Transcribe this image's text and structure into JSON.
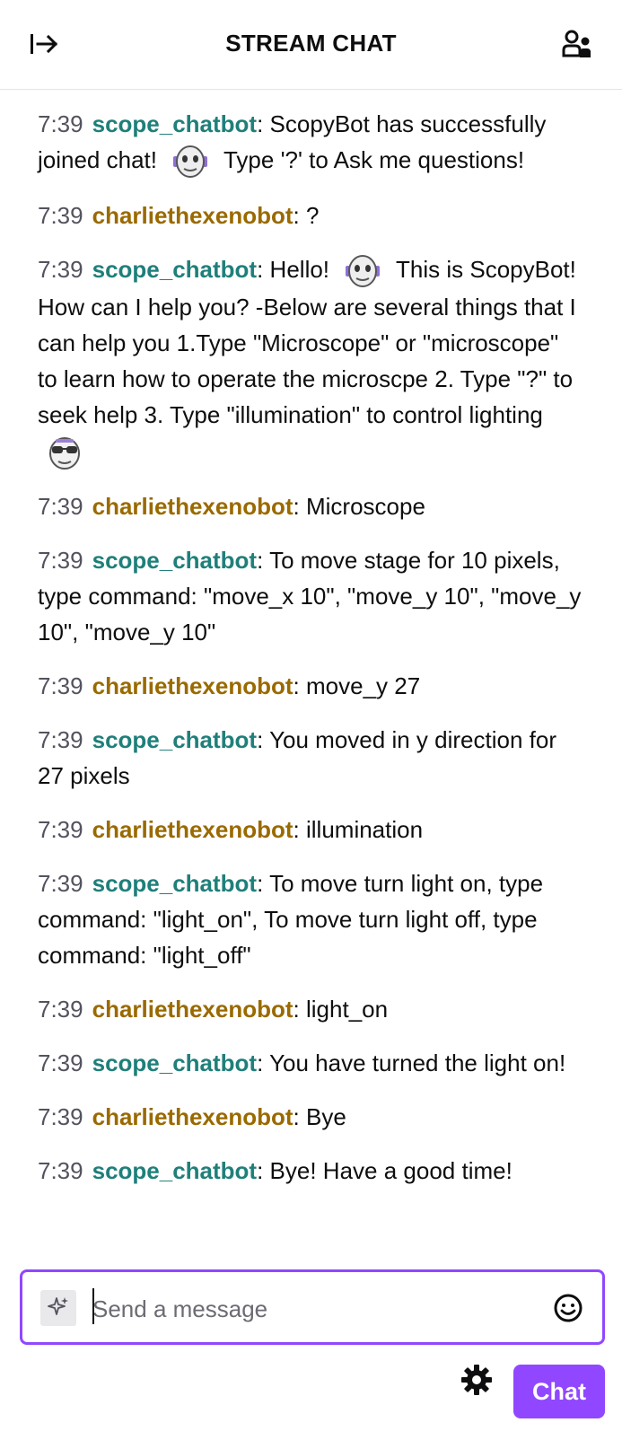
{
  "header": {
    "title": "STREAM CHAT",
    "collapse_icon": "collapse-right-icon",
    "users_icon": "community-users-icon"
  },
  "messages": [
    {
      "time": "7:39",
      "user": "scope_chatbot",
      "role": "bot",
      "parts": [
        {
          "text": ": ScopyBot has successfully joined chat! "
        },
        {
          "emote": "robot-face-emote"
        },
        {
          "text": " Type '?' to Ask me questions!"
        }
      ]
    },
    {
      "time": "7:39",
      "user": "charliethexenobot",
      "role": "human",
      "parts": [
        {
          "text": ": ?"
        }
      ]
    },
    {
      "time": "7:39",
      "user": "scope_chatbot",
      "role": "bot",
      "parts": [
        {
          "text": ": Hello! "
        },
        {
          "emote": "robot-face-emote"
        },
        {
          "text": " This is ScopyBot! How can I help you? -Below are several things that I can help you 1.Type \"Microscope\" or \"microscope\" to learn how to operate the microscpe 2. Type \"?\" to seek help 3. Type \"illumination\" to control lighting "
        },
        {
          "emote": "sunglasses-face-emote"
        }
      ]
    },
    {
      "time": "7:39",
      "user": "charliethexenobot",
      "role": "human",
      "parts": [
        {
          "text": ": Microscope"
        }
      ]
    },
    {
      "time": "7:39",
      "user": "scope_chatbot",
      "role": "bot",
      "parts": [
        {
          "text": ": To move stage for 10 pixels, type command: \"move_x 10\", \"move_y 10\", \"move_y 10\", \"move_y 10\""
        }
      ]
    },
    {
      "time": "7:39",
      "user": "charliethexenobot",
      "role": "human",
      "parts": [
        {
          "text": ": move_y 27"
        }
      ]
    },
    {
      "time": "7:39",
      "user": "scope_chatbot",
      "role": "bot",
      "parts": [
        {
          "text": ": You moved in y direction for 27 pixels"
        }
      ]
    },
    {
      "time": "7:39",
      "user": "charliethexenobot",
      "role": "human",
      "parts": [
        {
          "text": ": illumination"
        }
      ]
    },
    {
      "time": "7:39",
      "user": "scope_chatbot",
      "role": "bot",
      "parts": [
        {
          "text": ": To move turn light on, type command: \"light_on\", To move turn light off, type command: \"light_off\""
        }
      ]
    },
    {
      "time": "7:39",
      "user": "charliethexenobot",
      "role": "human",
      "parts": [
        {
          "text": ": light_on"
        }
      ]
    },
    {
      "time": "7:39",
      "user": "scope_chatbot",
      "role": "bot",
      "parts": [
        {
          "text": ": You have turned the light on!"
        }
      ]
    },
    {
      "time": "7:39",
      "user": "charliethexenobot",
      "role": "human",
      "parts": [
        {
          "text": ": Bye"
        }
      ]
    },
    {
      "time": "7:39",
      "user": "scope_chatbot",
      "role": "bot",
      "parts": [
        {
          "text": ": Bye! Have a good time!"
        }
      ]
    }
  ],
  "composer": {
    "placeholder": "Send a message",
    "value": "",
    "spark_icon": "sparkle-icon",
    "emoji_icon": "smiley-icon"
  },
  "footer": {
    "settings_icon": "gear-icon",
    "chat_label": "Chat"
  },
  "colors": {
    "accent": "#9147ff",
    "bot_name": "#1f7f7a",
    "human_name": "#9a6a00"
  }
}
